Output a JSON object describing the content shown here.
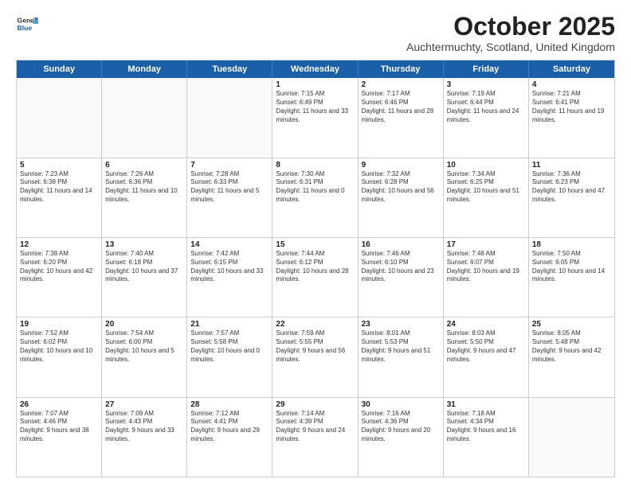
{
  "header": {
    "logo_general": "General",
    "logo_blue": "Blue",
    "month_title": "October 2025",
    "location": "Auchtermuchty, Scotland, United Kingdom"
  },
  "days_of_week": [
    "Sunday",
    "Monday",
    "Tuesday",
    "Wednesday",
    "Thursday",
    "Friday",
    "Saturday"
  ],
  "weeks": [
    [
      {
        "day": "",
        "text": ""
      },
      {
        "day": "",
        "text": ""
      },
      {
        "day": "",
        "text": ""
      },
      {
        "day": "1",
        "text": "Sunrise: 7:15 AM\nSunset: 6:49 PM\nDaylight: 11 hours and 33 minutes."
      },
      {
        "day": "2",
        "text": "Sunrise: 7:17 AM\nSunset: 6:46 PM\nDaylight: 11 hours and 28 minutes."
      },
      {
        "day": "3",
        "text": "Sunrise: 7:19 AM\nSunset: 6:44 PM\nDaylight: 11 hours and 24 minutes."
      },
      {
        "day": "4",
        "text": "Sunrise: 7:21 AM\nSunset: 6:41 PM\nDaylight: 11 hours and 19 minutes."
      }
    ],
    [
      {
        "day": "5",
        "text": "Sunrise: 7:23 AM\nSunset: 6:38 PM\nDaylight: 11 hours and 14 minutes."
      },
      {
        "day": "6",
        "text": "Sunrise: 7:26 AM\nSunset: 6:36 PM\nDaylight: 11 hours and 10 minutes."
      },
      {
        "day": "7",
        "text": "Sunrise: 7:28 AM\nSunset: 6:33 PM\nDaylight: 11 hours and 5 minutes."
      },
      {
        "day": "8",
        "text": "Sunrise: 7:30 AM\nSunset: 6:31 PM\nDaylight: 11 hours and 0 minutes."
      },
      {
        "day": "9",
        "text": "Sunrise: 7:32 AM\nSunset: 6:28 PM\nDaylight: 10 hours and 56 minutes."
      },
      {
        "day": "10",
        "text": "Sunrise: 7:34 AM\nSunset: 6:25 PM\nDaylight: 10 hours and 51 minutes."
      },
      {
        "day": "11",
        "text": "Sunrise: 7:36 AM\nSunset: 6:23 PM\nDaylight: 10 hours and 47 minutes."
      }
    ],
    [
      {
        "day": "12",
        "text": "Sunrise: 7:38 AM\nSunset: 6:20 PM\nDaylight: 10 hours and 42 minutes."
      },
      {
        "day": "13",
        "text": "Sunrise: 7:40 AM\nSunset: 6:18 PM\nDaylight: 10 hours and 37 minutes."
      },
      {
        "day": "14",
        "text": "Sunrise: 7:42 AM\nSunset: 6:15 PM\nDaylight: 10 hours and 33 minutes."
      },
      {
        "day": "15",
        "text": "Sunrise: 7:44 AM\nSunset: 6:12 PM\nDaylight: 10 hours and 28 minutes."
      },
      {
        "day": "16",
        "text": "Sunrise: 7:46 AM\nSunset: 6:10 PM\nDaylight: 10 hours and 23 minutes."
      },
      {
        "day": "17",
        "text": "Sunrise: 7:48 AM\nSunset: 6:07 PM\nDaylight: 10 hours and 19 minutes."
      },
      {
        "day": "18",
        "text": "Sunrise: 7:50 AM\nSunset: 6:05 PM\nDaylight: 10 hours and 14 minutes."
      }
    ],
    [
      {
        "day": "19",
        "text": "Sunrise: 7:52 AM\nSunset: 6:02 PM\nDaylight: 10 hours and 10 minutes."
      },
      {
        "day": "20",
        "text": "Sunrise: 7:54 AM\nSunset: 6:00 PM\nDaylight: 10 hours and 5 minutes."
      },
      {
        "day": "21",
        "text": "Sunrise: 7:57 AM\nSunset: 5:58 PM\nDaylight: 10 hours and 0 minutes."
      },
      {
        "day": "22",
        "text": "Sunrise: 7:59 AM\nSunset: 5:55 PM\nDaylight: 9 hours and 56 minutes."
      },
      {
        "day": "23",
        "text": "Sunrise: 8:01 AM\nSunset: 5:53 PM\nDaylight: 9 hours and 51 minutes."
      },
      {
        "day": "24",
        "text": "Sunrise: 8:03 AM\nSunset: 5:50 PM\nDaylight: 9 hours and 47 minutes."
      },
      {
        "day": "25",
        "text": "Sunrise: 8:05 AM\nSunset: 5:48 PM\nDaylight: 9 hours and 42 minutes."
      }
    ],
    [
      {
        "day": "26",
        "text": "Sunrise: 7:07 AM\nSunset: 4:46 PM\nDaylight: 9 hours and 38 minutes."
      },
      {
        "day": "27",
        "text": "Sunrise: 7:09 AM\nSunset: 4:43 PM\nDaylight: 9 hours and 33 minutes."
      },
      {
        "day": "28",
        "text": "Sunrise: 7:12 AM\nSunset: 4:41 PM\nDaylight: 9 hours and 29 minutes."
      },
      {
        "day": "29",
        "text": "Sunrise: 7:14 AM\nSunset: 4:39 PM\nDaylight: 9 hours and 24 minutes."
      },
      {
        "day": "30",
        "text": "Sunrise: 7:16 AM\nSunset: 4:36 PM\nDaylight: 9 hours and 20 minutes."
      },
      {
        "day": "31",
        "text": "Sunrise: 7:18 AM\nSunset: 4:34 PM\nDaylight: 9 hours and 16 minutes."
      },
      {
        "day": "",
        "text": ""
      }
    ]
  ]
}
